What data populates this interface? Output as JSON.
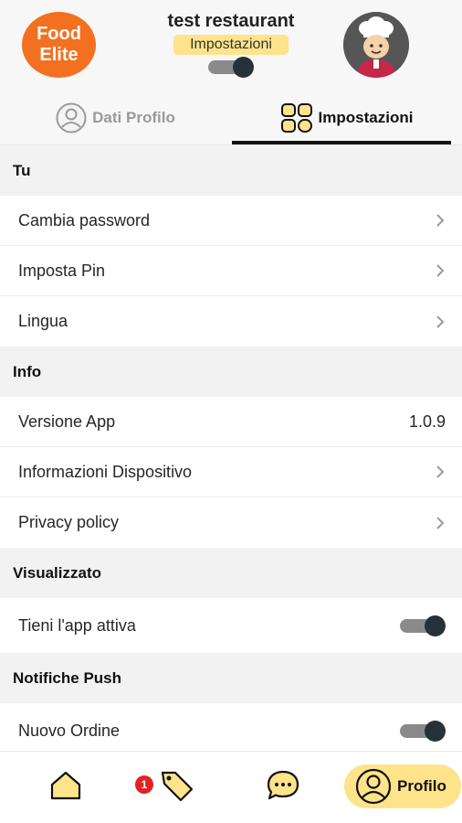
{
  "header": {
    "logo_line1": "Food",
    "logo_line2": "Elite",
    "restaurant_name": "test restaurant",
    "mode_badge": "Impostazioni",
    "header_toggle_on": true
  },
  "tabs": [
    {
      "label": "Dati Profilo",
      "active": false
    },
    {
      "label": "Impostazioni",
      "active": true
    }
  ],
  "sections": {
    "you": {
      "title": "Tu",
      "items": [
        "Cambia password",
        "Imposta Pin",
        "Lingua"
      ]
    },
    "info": {
      "title": "Info",
      "app_version_label": "Versione App",
      "app_version_value": "1.0.9",
      "device_info_label": "Informazioni Dispositivo",
      "privacy_label": "Privacy policy"
    },
    "display": {
      "title": "Visualizzato",
      "keep_active_label": "Tieni l'app attiva",
      "keep_active_on": true
    },
    "push": {
      "title": "Notifiche Push",
      "new_order_label": "Nuovo Ordine",
      "new_order_on": true
    }
  },
  "bottom_nav": {
    "home_icon": "home-icon",
    "offers_icon": "tag-icon",
    "offers_badge": "1",
    "chat_icon": "chat-icon",
    "profile_label": "Profilo"
  },
  "colors": {
    "brand_orange": "#f37021",
    "accent_yellow": "#fde38a",
    "toggle_knob": "#263238",
    "badge_red": "#e02424"
  }
}
